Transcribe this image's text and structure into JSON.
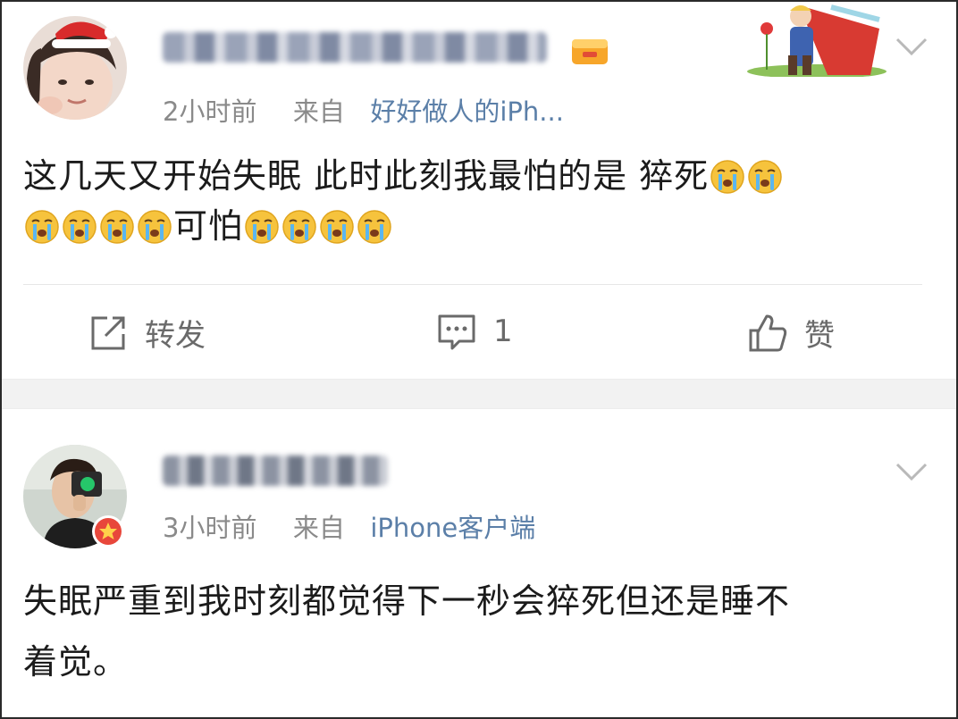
{
  "posts": [
    {
      "time": "2小时前",
      "from_label": "来自",
      "source": "好好做人的iPh...",
      "body_line1": "这几天又开始失眠 此时此刻我最怕的是 猝死",
      "body_line2_mid": "可怕",
      "actions": {
        "repost_label": "转发",
        "comment_count": "1",
        "like_label": "赞"
      },
      "emoji": "crying-emoji"
    },
    {
      "time": "3小时前",
      "from_label": "来自",
      "source": "iPhone客户端",
      "body_line1": "失眠严重到我时刻都觉得下一秒会猝死但还是睡不",
      "body_line2": "着觉。"
    }
  ],
  "colors": {
    "meta_gray": "#8a8a8a",
    "source_blue": "#5b7fa8",
    "separator": "#f2f2f2",
    "text": "#1b1b1b"
  },
  "icons": {
    "repost": "share-box-icon",
    "comment": "comment-bubble-icon",
    "like": "thumbs-up-icon",
    "menu": "chevron-down-icon"
  }
}
